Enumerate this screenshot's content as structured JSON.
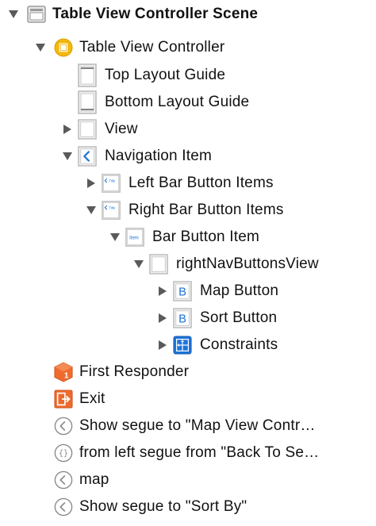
{
  "scene": {
    "title": "Table View Controller Scene",
    "controller": {
      "label": "Table View Controller",
      "top_guide": "Top Layout Guide",
      "bottom_guide": "Bottom Layout Guide",
      "view": "View",
      "nav_item": {
        "label": "Navigation Item",
        "left_items": "Left Bar Button Items",
        "right_items": "Right Bar Button Items",
        "bar_button_item": "Bar Button Item",
        "icon_text_item": "Item",
        "icon_text_title": "Title",
        "custom_view": "rightNavButtonsView",
        "map_button": "Map Button",
        "sort_button": "Sort Button",
        "constraints": "Constraints",
        "button_glyph": "B"
      }
    },
    "first_responder": "First Responder",
    "exit": "Exit",
    "segues": [
      "Show segue to \"Map View Contr…",
      "from left segue from \"Back To Se…",
      "map",
      "Show segue to \"Sort By\""
    ]
  },
  "colors": {
    "accent_blue": "#1e73d9",
    "controller_yellow": "#f3b80d",
    "responder_orange": "#ef6c2e",
    "exit_orange": "#ee6a2c",
    "disclosure": "#5a5a5a",
    "icon_border": "#b8b8b8"
  }
}
